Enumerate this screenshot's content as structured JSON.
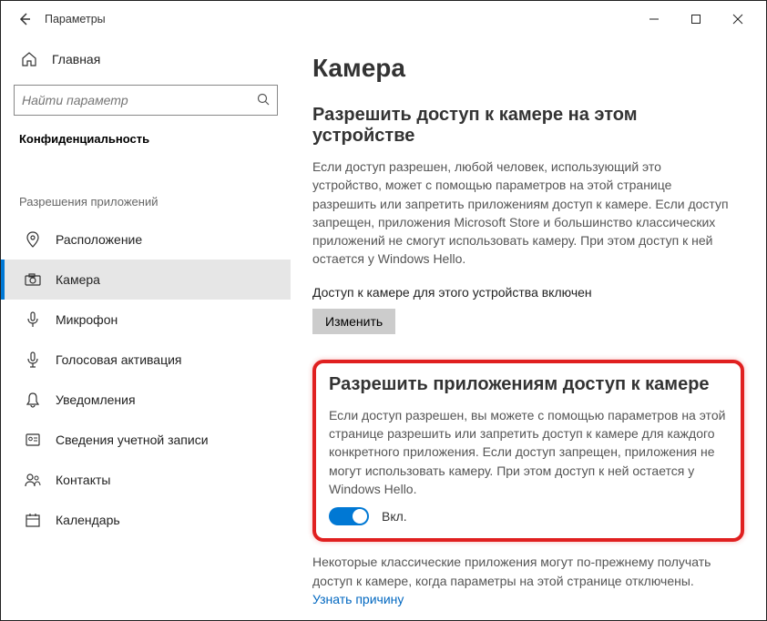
{
  "app_title": "Параметры",
  "win": {
    "min": "—",
    "max": "□",
    "close": "✕"
  },
  "home_label": "Главная",
  "search_placeholder": "Найти параметр",
  "category": "Конфиденциальность",
  "section_label": "Разрешения приложений",
  "nav": [
    {
      "icon": "location",
      "label": "Расположение"
    },
    {
      "icon": "camera",
      "label": "Камера"
    },
    {
      "icon": "mic",
      "label": "Микрофон"
    },
    {
      "icon": "voice",
      "label": "Голосовая активация"
    },
    {
      "icon": "bell",
      "label": "Уведомления"
    },
    {
      "icon": "account",
      "label": "Сведения учетной записи"
    },
    {
      "icon": "contacts",
      "label": "Контакты"
    },
    {
      "icon": "calendar",
      "label": "Календарь"
    }
  ],
  "main": {
    "title": "Камера",
    "s1_heading": "Разрешить доступ к камере на этом устройстве",
    "s1_para": "Если доступ разрешен, любой человек, использующий это устройство, может с помощью параметров на этой странице разрешить или запретить приложениям доступ к камере. Если доступ запрещен, приложения Microsoft Store и большинство классических приложений не смогут использовать камеру. При этом доступ к ней остается у Windows Hello.",
    "s1_status": "Доступ к камере для этого устройства включен",
    "s1_button": "Изменить",
    "s2_heading": "Разрешить приложениям доступ к камере",
    "s2_para": "Если доступ разрешен, вы можете с помощью параметров на этой странице разрешить или запретить доступ к камере для каждого конкретного приложения. Если доступ запрещен, приложения не могут использовать камеру. При этом доступ к ней остается у Windows Hello.",
    "toggle_label": "Вкл.",
    "note_prefix": "Некоторые классические приложения могут по-прежнему получать доступ к камере, когда параметры на этой странице отключены. ",
    "note_link": "Узнать причину"
  }
}
